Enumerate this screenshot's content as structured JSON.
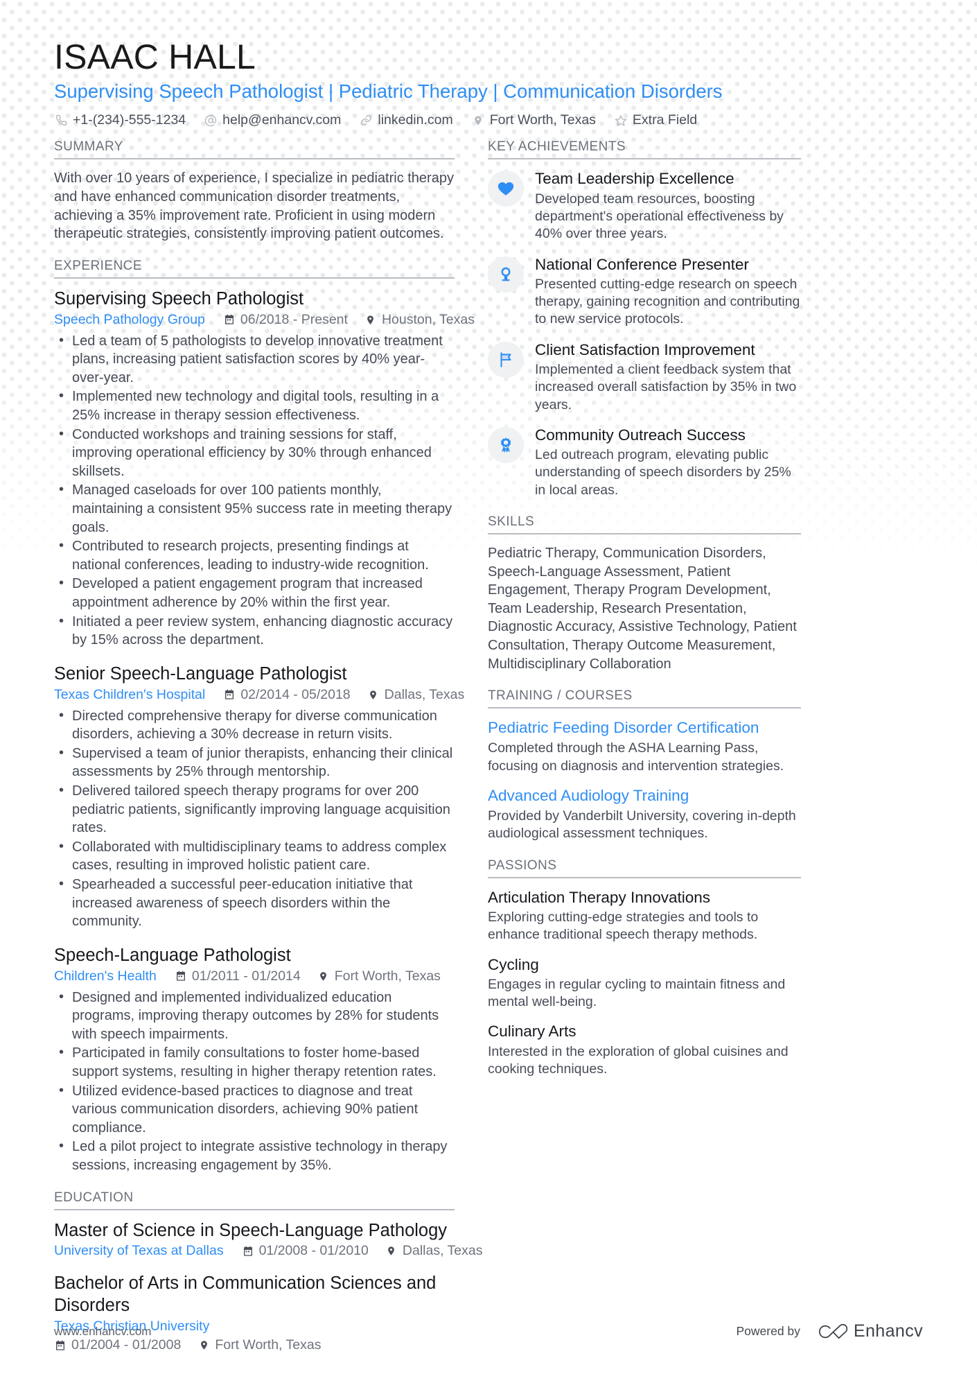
{
  "header": {
    "name": "ISAAC HALL",
    "headline": "Supervising Speech Pathologist | Pediatric Therapy | Communication Disorders",
    "contacts": [
      {
        "icon": "phone-icon",
        "text": "+1-(234)-555-1234"
      },
      {
        "icon": "email-icon",
        "text": "help@enhancv.com"
      },
      {
        "icon": "link-icon",
        "text": "linkedin.com"
      },
      {
        "icon": "location-icon",
        "text": "Fort Worth, Texas"
      },
      {
        "icon": "star-icon",
        "text": "Extra Field"
      }
    ]
  },
  "summary": {
    "title": "SUMMARY",
    "text": "With over 10 years of experience, I specialize in pediatric therapy and have enhanced communication disorder treatments, achieving a 35% improvement rate. Proficient in using modern therapeutic strategies, consistently improving patient outcomes."
  },
  "experience": {
    "title": "EXPERIENCE",
    "entries": [
      {
        "role": "Supervising Speech Pathologist",
        "org": "Speech Pathology Group",
        "dates": "06/2018 - Present",
        "location": "Houston, Texas",
        "bullets": [
          "Led a team of 5 pathologists to develop innovative treatment plans, increasing patient satisfaction scores by 40% year-over-year.",
          "Implemented new technology and digital tools, resulting in a 25% increase in therapy session effectiveness.",
          "Conducted workshops and training sessions for staff, improving operational efficiency by 30% through enhanced skillsets.",
          "Managed caseloads for over 100 patients monthly, maintaining a consistent 95% success rate in meeting therapy goals.",
          "Contributed to research projects, presenting findings at national conferences, leading to industry-wide recognition.",
          "Developed a patient engagement program that increased appointment adherence by 20% within the first year.",
          "Initiated a peer review system, enhancing diagnostic accuracy by 15% across the department."
        ]
      },
      {
        "role": "Senior Speech-Language Pathologist",
        "org": "Texas Children's Hospital",
        "dates": "02/2014 - 05/2018",
        "location": "Dallas, Texas",
        "bullets": [
          "Directed comprehensive therapy for diverse communication disorders, achieving a 30% decrease in return visits.",
          "Supervised a team of junior therapists, enhancing their clinical assessments by 25% through mentorship.",
          "Delivered tailored speech therapy programs for over 200 pediatric patients, significantly improving language acquisition rates.",
          "Collaborated with multidisciplinary teams to address complex cases, resulting in improved holistic patient care.",
          "Spearheaded a successful peer-education initiative that increased awareness of speech disorders within the community."
        ]
      },
      {
        "role": "Speech-Language Pathologist",
        "org": "Children's Health",
        "dates": "01/2011 - 01/2014",
        "location": "Fort Worth, Texas",
        "bullets": [
          "Designed and implemented individualized education programs, improving therapy outcomes by 28% for students with speech impairments.",
          "Participated in family consultations to foster home-based support systems, resulting in higher therapy retention rates.",
          "Utilized evidence-based practices to diagnose and treat various communication disorders, achieving 90% patient compliance.",
          "Led a pilot project to integrate assistive technology in therapy sessions, increasing engagement by 35%."
        ]
      }
    ]
  },
  "education": {
    "title": "EDUCATION",
    "entries": [
      {
        "degree": "Master of Science in Speech-Language Pathology",
        "school": "University of Texas at Dallas",
        "dates": "01/2008 - 01/2010",
        "location": "Dallas, Texas",
        "stacked": false
      },
      {
        "degree": "Bachelor of Arts in Communication Sciences and Disorders",
        "school": "Texas Christian University",
        "dates": "01/2004 - 01/2008",
        "location": "Fort Worth, Texas",
        "stacked": true
      }
    ]
  },
  "achievements": {
    "title": "KEY ACHIEVEMENTS",
    "items": [
      {
        "icon": "heart-icon",
        "title": "Team Leadership Excellence",
        "desc": "Developed team resources, boosting department's operational effectiveness by 40% over three years."
      },
      {
        "icon": "microphone-icon",
        "title": "National Conference Presenter",
        "desc": "Presented cutting-edge research on speech therapy, gaining recognition and contributing to new service protocols."
      },
      {
        "icon": "flag-icon",
        "title": "Client Satisfaction Improvement",
        "desc": "Implemented a client feedback system that increased overall satisfaction by 35% in two years."
      },
      {
        "icon": "award-icon",
        "title": "Community Outreach Success",
        "desc": "Led outreach program, elevating public understanding of speech disorders by 25% in local areas."
      }
    ]
  },
  "skills": {
    "title": "SKILLS",
    "text": "Pediatric Therapy, Communication Disorders, Speech-Language Assessment, Patient Engagement, Therapy Program Development, Team Leadership, Research Presentation, Diagnostic Accuracy, Assistive Technology, Patient Consultation, Therapy Outcome Measurement, Multidisciplinary Collaboration"
  },
  "training": {
    "title": "TRAINING / COURSES",
    "items": [
      {
        "title": "Pediatric Feeding Disorder Certification",
        "desc": "Completed through the ASHA Learning Pass, focusing on diagnosis and intervention strategies."
      },
      {
        "title": "Advanced Audiology Training",
        "desc": "Provided by Vanderbilt University, covering in-depth audiological assessment techniques."
      }
    ]
  },
  "passions": {
    "title": "PASSIONS",
    "items": [
      {
        "title": "Articulation Therapy Innovations",
        "desc": "Exploring cutting-edge strategies and tools to enhance traditional speech therapy methods."
      },
      {
        "title": "Cycling",
        "desc": "Engages in regular cycling to maintain fitness and mental well-being."
      },
      {
        "title": "Culinary Arts",
        "desc": "Interested in the exploration of global cuisines and cooking techniques."
      }
    ]
  },
  "footer": {
    "url": "www.enhancv.com",
    "powered_by": "Powered by",
    "brand": "Enhancv"
  },
  "colors": {
    "accent": "#2f8ef4",
    "heading": "#16181d",
    "body": "#454a55",
    "muted": "#6b7079",
    "rule": "#b9bcc1",
    "icon_bubble": "#f0f1f2",
    "dot": "#e9ebec"
  }
}
